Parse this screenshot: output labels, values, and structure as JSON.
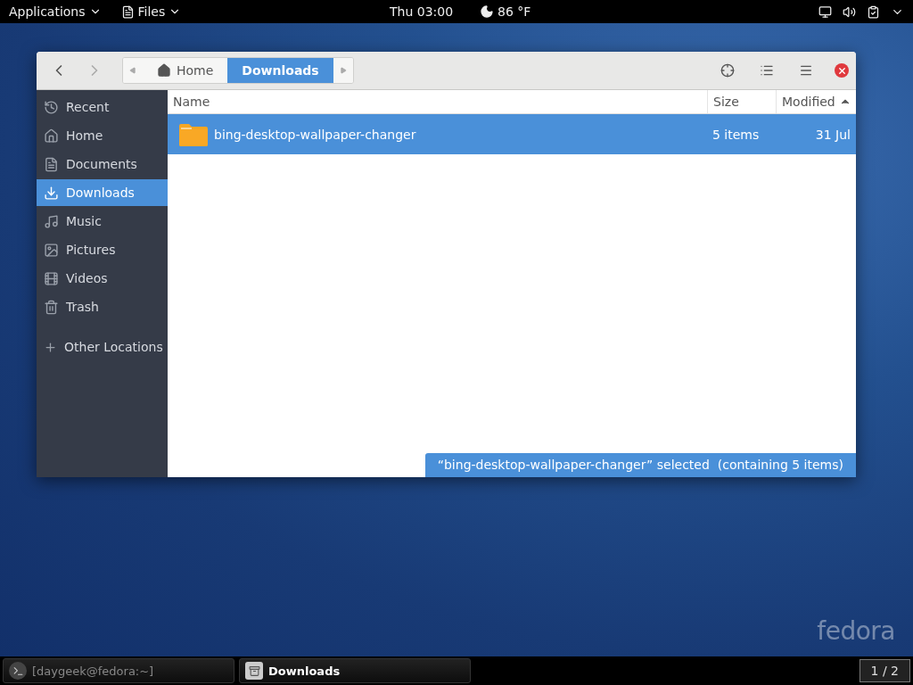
{
  "top_bar": {
    "applications_menu": "Applications",
    "app_menu": "Files",
    "clock": "Thu 03:00",
    "weather": "86 °F"
  },
  "window": {
    "path_bar": [
      {
        "label": "Home",
        "selected": false
      },
      {
        "label": "Downloads",
        "selected": true
      }
    ],
    "sidebar": {
      "items": [
        {
          "label": "Recent",
          "selected": false
        },
        {
          "label": "Home",
          "selected": false
        },
        {
          "label": "Documents",
          "selected": false
        },
        {
          "label": "Downloads",
          "selected": true
        },
        {
          "label": "Music",
          "selected": false
        },
        {
          "label": "Pictures",
          "selected": false
        },
        {
          "label": "Videos",
          "selected": false
        },
        {
          "label": "Trash",
          "selected": false
        }
      ],
      "other_locations": "Other Locations"
    },
    "table": {
      "columns": [
        {
          "label": "Name",
          "sorted": false
        },
        {
          "label": "Size",
          "sorted": false
        },
        {
          "label": "Modified",
          "sorted": true
        }
      ],
      "rows": [
        {
          "name": "bing-desktop-wallpaper-changer",
          "size": "5 items",
          "modified": "31 Jul",
          "selected": true
        }
      ]
    },
    "status": "“bing-desktop-wallpaper-changer” selected  (containing 5 items)"
  },
  "taskbar": {
    "tasks": [
      {
        "label": "[daygeek@fedora:~]",
        "selected": false
      },
      {
        "label": "Downloads",
        "selected": true
      }
    ],
    "workspace": "1 / 2"
  },
  "watermark_logo": "fedora"
}
